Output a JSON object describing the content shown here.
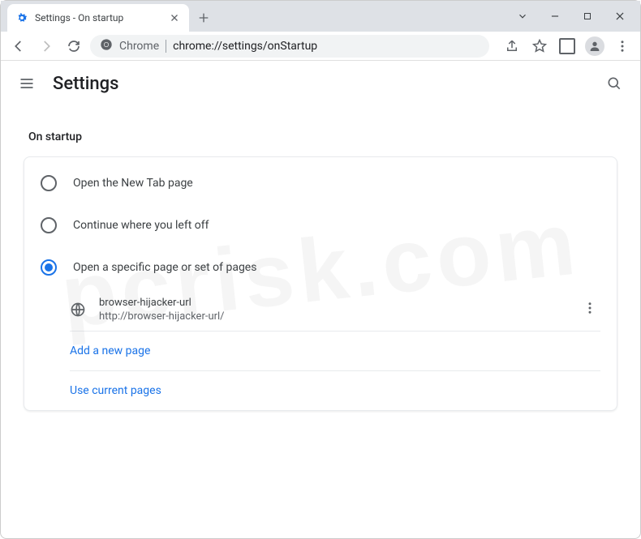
{
  "tab": {
    "title": "Settings - On startup"
  },
  "omnibox": {
    "label": "Chrome",
    "url": "chrome://settings/onStartup"
  },
  "header": {
    "title": "Settings"
  },
  "section": {
    "heading": "On startup"
  },
  "options": {
    "newTab": "Open the New Tab page",
    "continue": "Continue where you left off",
    "specific": "Open a specific page or set of pages"
  },
  "site": {
    "name": "browser-hijacker-url",
    "url": "http://browser-hijacker-url/"
  },
  "links": {
    "addPage": "Add a new page",
    "useCurrent": "Use current pages"
  },
  "watermark": "pcrisk.com"
}
